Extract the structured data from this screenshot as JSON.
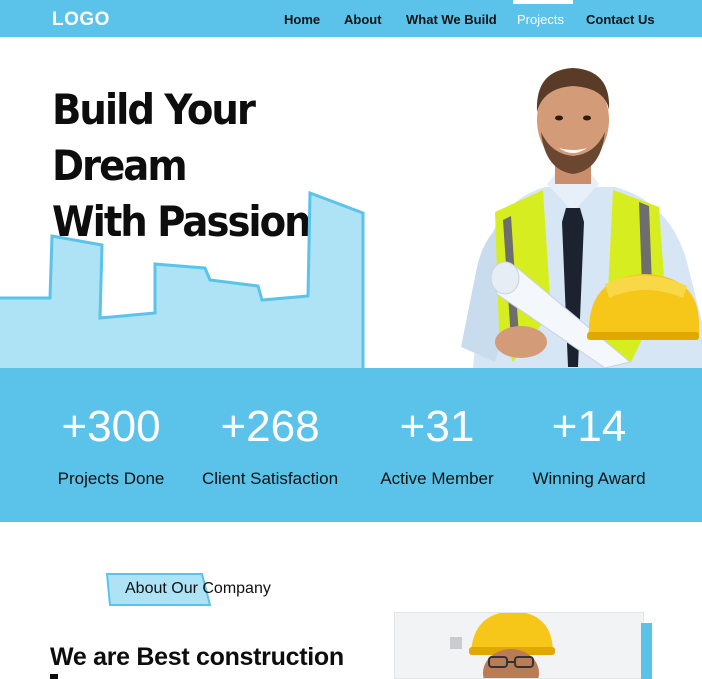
{
  "nav": {
    "logo": "LOGO",
    "items": [
      {
        "label": "Home"
      },
      {
        "label": "About"
      },
      {
        "label": "What We Build"
      },
      {
        "label": "Projects",
        "active": true
      },
      {
        "label": "Contact Us"
      }
    ]
  },
  "hero": {
    "title_line1": "Build Your Dream",
    "title_line2": "With Passion"
  },
  "stats": [
    {
      "number": "+300",
      "label": "Projects Done"
    },
    {
      "number": "+268",
      "label": "Client Satisfaction"
    },
    {
      "number": "+31",
      "label": "Active Member"
    },
    {
      "number": "+14",
      "label": "Winning Award"
    }
  ],
  "about": {
    "tag": "About Our Company",
    "heading": "We are Best construction"
  },
  "colors": {
    "accent": "#5bc3ea",
    "accent_light": "#ade3f5",
    "vest": "#d6ee1f",
    "helmet": "#f6c619"
  },
  "icons": {
    "hero_person": "engineer-with-blueprints-illustration",
    "about_photo": "worker-with-helmet-photo"
  }
}
